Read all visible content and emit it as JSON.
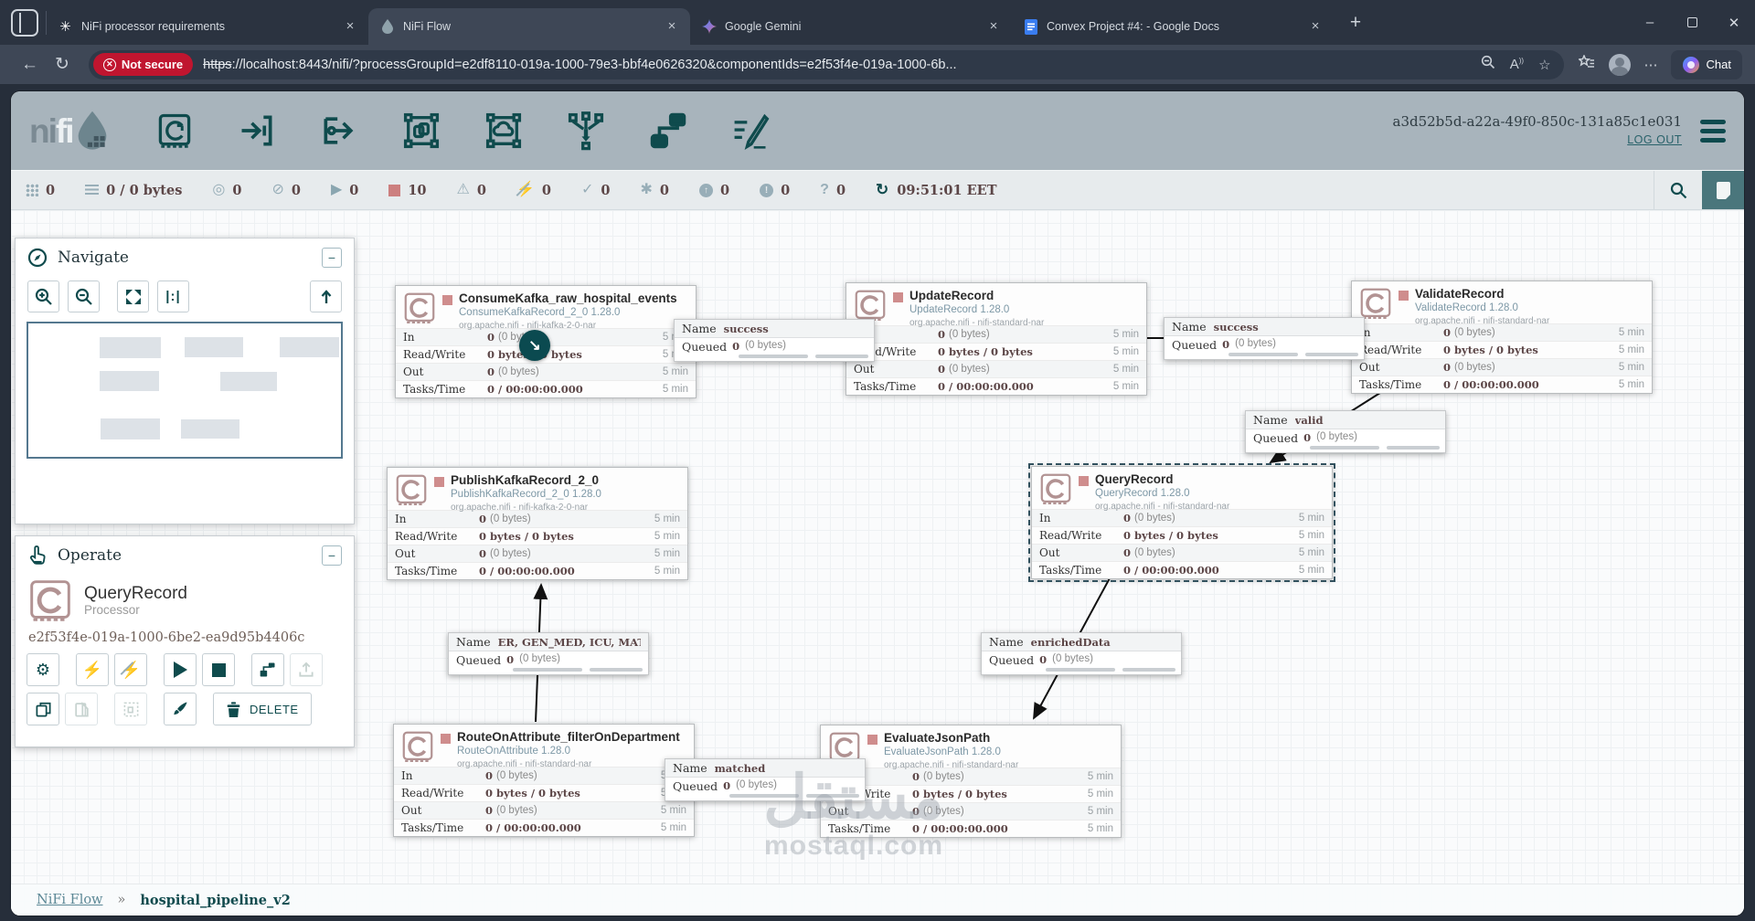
{
  "browser": {
    "tabs": [
      {
        "title": "NiFi processor requirements"
      },
      {
        "title": "NiFi Flow"
      },
      {
        "title": "Google Gemini"
      },
      {
        "title": "Convex Project #4: - Google Docs"
      }
    ],
    "new_tab_label": "+",
    "close_glyph": "×",
    "window": {
      "minimize": "–",
      "close": "✕"
    },
    "address": {
      "security_label": "Not secure",
      "url_scheme": "https",
      "url_rest": "://localhost:8443/nifi/?processGroupId=e2df8110-019a-1000-79e3-bbf4e0626320&componentIds=e2f53f4e-019a-1000-6b...",
      "chat_label": "Chat"
    }
  },
  "header": {
    "logo_ni": "ni",
    "logo_fi": "fi",
    "session_id": "a3d52b5d-a22a-49f0-850c-131a85c1e031",
    "logout_label": "LOG OUT"
  },
  "status": {
    "active_threads": "0",
    "queued": "0 / 0 bytes",
    "transmitting": "0",
    "not_transmitting": "0",
    "running": "0",
    "stopped": "10",
    "invalid": "0",
    "disabled": "0",
    "up_to_date": "0",
    "locally_modified": "0",
    "stale": "0",
    "locally_modified_stale": "0",
    "sync_failure": "0",
    "refresh_time": "09:51:01 EET"
  },
  "navigate": {
    "title": "Navigate"
  },
  "operate": {
    "title": "Operate",
    "name": "QueryRecord",
    "type_label": "Processor",
    "id": "e2f53f4e-019a-1000-6be2-ea9d95b4406c",
    "delete_label": "DELETE"
  },
  "stats": {
    "labels": [
      "In",
      "Read/Write",
      "Out",
      "Tasks/Time"
    ],
    "in_count": "0",
    "in_size": "(0 bytes)",
    "read_write": "0 bytes / 0 bytes",
    "out_count": "0",
    "out_size": "(0 bytes)",
    "tasks_time": "0 / 00:00:00.000",
    "window": "5 min"
  },
  "processors": [
    {
      "name": "ConsumeKafka_raw_hospital_events",
      "type": "ConsumeKafkaRecord_2_0 1.28.0",
      "bundle": "org.apache.nifi - nifi-kafka-2-0-nar"
    },
    {
      "name": "UpdateRecord",
      "type": "UpdateRecord 1.28.0",
      "bundle": "org.apache.nifi - nifi-standard-nar"
    },
    {
      "name": "ValidateRecord",
      "type": "ValidateRecord 1.28.0",
      "bundle": "org.apache.nifi - nifi-standard-nar"
    },
    {
      "name": "QueryRecord",
      "type": "QueryRecord 1.28.0",
      "bundle": "org.apache.nifi - nifi-standard-nar"
    },
    {
      "name": "PublishKafkaRecord_2_0",
      "type": "PublishKafkaRecord_2_0 1.28.0",
      "bundle": "org.apache.nifi - nifi-kafka-2-0-nar"
    },
    {
      "name": "RouteOnAttribute_filterOnDepartment",
      "type": "RouteOnAttribute 1.28.0",
      "bundle": "org.apache.nifi - nifi-standard-nar"
    },
    {
      "name": "EvaluateJsonPath",
      "type": "EvaluateJsonPath 1.28.0",
      "bundle": "org.apache.nifi - nifi-standard-nar"
    }
  ],
  "connection_labels": [
    {
      "name_label": "Name",
      "name": "success",
      "queued_label": "Queued",
      "count": "0",
      "size": "(0 bytes)"
    },
    {
      "name_label": "Name",
      "name": "success",
      "queued_label": "Queued",
      "count": "0",
      "size": "(0 bytes)"
    },
    {
      "name_label": "Name",
      "name": "valid",
      "queued_label": "Queued",
      "count": "0",
      "size": "(0 bytes)"
    },
    {
      "name_label": "Name",
      "name": "ER, GEN_MED, ICU, MATER...",
      "queued_label": "Queued",
      "count": "0",
      "size": "(0 bytes)"
    },
    {
      "name_label": "Name",
      "name": "enrichedData",
      "queued_label": "Queued",
      "count": "0",
      "size": "(0 bytes)"
    },
    {
      "name_label": "Name",
      "name": "matched",
      "queued_label": "Queued",
      "count": "0",
      "size": "(0 bytes)"
    }
  ],
  "breadcrumb": {
    "root": "NiFi Flow",
    "separator": "»",
    "current": "hospital_pipeline_v2"
  },
  "watermark": {
    "arabic": "مستقل",
    "latin": "mostaql.com"
  }
}
